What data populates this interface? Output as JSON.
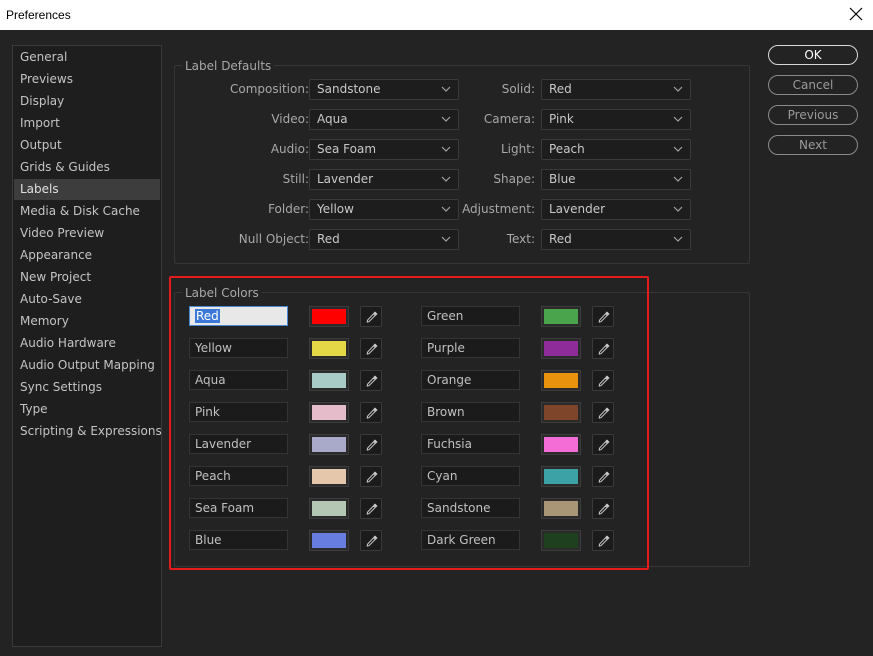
{
  "window": {
    "title": "Preferences"
  },
  "sidebar": {
    "items": [
      {
        "label": "General"
      },
      {
        "label": "Previews"
      },
      {
        "label": "Display"
      },
      {
        "label": "Import"
      },
      {
        "label": "Output"
      },
      {
        "label": "Grids & Guides"
      },
      {
        "label": "Labels",
        "active": true
      },
      {
        "label": "Media & Disk Cache"
      },
      {
        "label": "Video Preview"
      },
      {
        "label": "Appearance"
      },
      {
        "label": "New Project"
      },
      {
        "label": "Auto-Save"
      },
      {
        "label": "Memory"
      },
      {
        "label": "Audio Hardware"
      },
      {
        "label": "Audio Output Mapping"
      },
      {
        "label": "Sync Settings"
      },
      {
        "label": "Type"
      },
      {
        "label": "Scripting & Expressions"
      }
    ]
  },
  "label_defaults": {
    "title": "Label Defaults",
    "left": [
      {
        "label": "Composition:",
        "value": "Sandstone"
      },
      {
        "label": "Video:",
        "value": "Aqua"
      },
      {
        "label": "Audio:",
        "value": "Sea Foam"
      },
      {
        "label": "Still:",
        "value": "Lavender"
      },
      {
        "label": "Folder:",
        "value": "Yellow"
      },
      {
        "label": "Null Object:",
        "value": "Red"
      }
    ],
    "right": [
      {
        "label": "Solid:",
        "value": "Red"
      },
      {
        "label": "Camera:",
        "value": "Pink"
      },
      {
        "label": "Light:",
        "value": "Peach"
      },
      {
        "label": "Shape:",
        "value": "Blue"
      },
      {
        "label": "Adjustment:",
        "value": "Lavender"
      },
      {
        "label": "Text:",
        "value": "Red"
      }
    ]
  },
  "label_colors": {
    "title": "Label Colors",
    "left": [
      {
        "name": "Red",
        "color": "#ff0000",
        "focused": true
      },
      {
        "name": "Yellow",
        "color": "#e5d847"
      },
      {
        "name": "Aqua",
        "color": "#a9cbc7"
      },
      {
        "name": "Pink",
        "color": "#e5bcc9"
      },
      {
        "name": "Lavender",
        "color": "#a9a9ca"
      },
      {
        "name": "Peach",
        "color": "#e5c8ac"
      },
      {
        "name": "Sea Foam",
        "color": "#b4c7b4"
      },
      {
        "name": "Blue",
        "color": "#677de0"
      }
    ],
    "right": [
      {
        "name": "Green",
        "color": "#4aa44c"
      },
      {
        "name": "Purple",
        "color": "#8e2c9a"
      },
      {
        "name": "Orange",
        "color": "#e8920d"
      },
      {
        "name": "Brown",
        "color": "#7f452a"
      },
      {
        "name": "Fuchsia",
        "color": "#f46dd6"
      },
      {
        "name": "Cyan",
        "color": "#3da2a5"
      },
      {
        "name": "Sandstone",
        "color": "#a89677"
      },
      {
        "name": "Dark Green",
        "color": "#1e401e"
      }
    ]
  },
  "buttons": {
    "ok": "OK",
    "cancel": "Cancel",
    "previous": "Previous",
    "next": "Next"
  },
  "icons": {
    "close": "close-icon",
    "dropdown": "chevron-down-icon",
    "eyedropper": "eyedropper-icon"
  },
  "accent": {
    "highlight": "#e31b1b",
    "selection": "#3b78d8"
  }
}
